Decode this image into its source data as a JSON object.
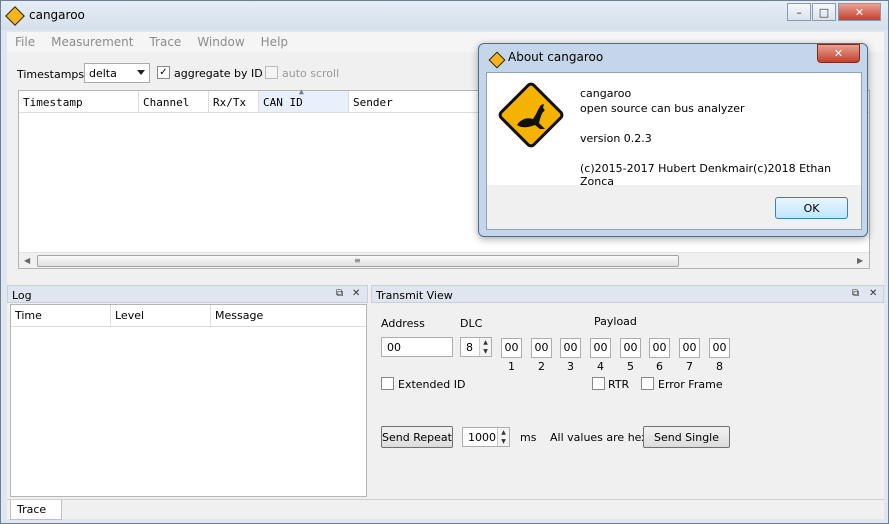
{
  "window": {
    "title": "cangaroo",
    "min": "–",
    "max": "□",
    "close": "✕"
  },
  "menu": [
    "File",
    "Measurement",
    "Trace",
    "Window",
    "Help"
  ],
  "trace": {
    "timestamps_label": "Timestamps:",
    "timestamps_value": "delta",
    "aggregate_label": "aggregate by ID",
    "aggregate_checked": true,
    "autoscroll_label": "auto scroll",
    "autoscroll_checked": false,
    "columns": [
      "Timestamp",
      "Channel",
      "Rx/Tx",
      "CAN ID",
      "Sender"
    ]
  },
  "log": {
    "title": "Log",
    "columns": [
      "Time",
      "Level",
      "Message"
    ]
  },
  "transmit": {
    "title": "Transmit View",
    "address_label": "Address",
    "address_value": "00",
    "dlc_label": "DLC",
    "dlc_value": "8",
    "payload_label": "Payload",
    "payload": [
      "00",
      "00",
      "00",
      "00",
      "00",
      "00",
      "00",
      "00"
    ],
    "indices": [
      "1",
      "2",
      "3",
      "4",
      "5",
      "6",
      "7",
      "8"
    ],
    "extended_label": "Extended ID",
    "rtr_label": "RTR",
    "error_frame_label": "Error Frame",
    "send_repeat": "Send Repeat",
    "interval_value": "1000",
    "ms_label": "ms",
    "hex_note": "All values are hex",
    "send_single": "Send Single"
  },
  "tabs": [
    "Trace"
  ],
  "about": {
    "title": "About cangaroo",
    "app_name": "cangaroo",
    "description": "open source can bus analyzer",
    "version": "version 0.2.3",
    "copyright": "(c)2015-2017 Hubert Denkmair(c)2018 Ethan Zonca",
    "ok_label": "OK",
    "close": "✕"
  },
  "colors": {
    "accent": "#f3b51b",
    "titlebar": "#dfe6ef",
    "close": "#c6402c"
  }
}
